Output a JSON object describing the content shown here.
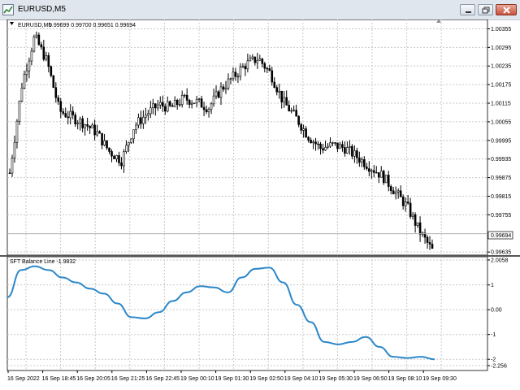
{
  "window": {
    "title": "EURUSD,M5"
  },
  "main_chart": {
    "header_symbol": "EURUSD,M5",
    "header_ohlc": "0.99699 0.99700 0.99651 0.99694",
    "current_price_label": "0.99694",
    "y_labels": [
      "1.00355",
      "1.00295",
      "1.00235",
      "1.00175",
      "1.00115",
      "1.00055",
      "0.99995",
      "0.99935",
      "0.99875",
      "0.99815",
      "0.99755",
      "0.99635"
    ]
  },
  "indicator": {
    "header": "SFT Balance Line -1.9832",
    "y_labels": [
      "2.0058",
      "1",
      "0.00",
      "-1",
      "-2",
      "-2.256"
    ]
  },
  "time_axis": [
    "16 Sep 2022",
    "16 Sep 18:45",
    "16 Sep 20:05",
    "16 Sep 21:25",
    "16 Sep 22:45",
    "19 Sep 00:10",
    "19 Sep 01:30",
    "19 Sep 02:50",
    "19 Sep 04:10",
    "19 Sep 05:30",
    "19 Sep 06:50",
    "19 Sep 08:10",
    "19 Sep 09:30"
  ],
  "chart_data": [
    {
      "type": "candlestick",
      "title": "EURUSD,M5",
      "x_categories": [
        "16 Sep 2022",
        "16 Sep 18:45",
        "16 Sep 20:05",
        "16 Sep 21:25",
        "16 Sep 22:45",
        "19 Sep 00:10",
        "19 Sep 01:30",
        "19 Sep 02:50",
        "19 Sep 04:10",
        "19 Sep 05:30",
        "19 Sep 06:50",
        "19 Sep 08:10",
        "19 Sep 09:30"
      ],
      "ylim": [
        0.99625,
        1.00385
      ],
      "close_path_approx": [
        0.9989,
        1.0018,
        1.0033,
        1.0025,
        1.0009,
        1.0007,
        1.0005,
        1.0002,
        0.9996,
        0.9993,
        1.0004,
        1.0008,
        1.0011,
        1.001,
        1.0013,
        1.0012,
        1.001,
        1.0016,
        1.002,
        1.0024,
        1.0026,
        1.0021,
        1.0012,
        1.0007,
        1.0001,
        0.9997,
        0.9998,
        0.9997,
        0.9994,
        0.9991,
        0.9988,
        0.9983,
        0.9978,
        0.997,
        0.9964
      ],
      "last_price": 0.99694,
      "grid": true
    },
    {
      "type": "line",
      "title": "SFT Balance Line -1.9832",
      "ylim": [
        -2.256,
        2.0058
      ],
      "series": [
        {
          "name": "SFT Balance Line",
          "values": [
            0.5,
            1.6,
            1.75,
            1.6,
            1.3,
            1.1,
            0.85,
            0.65,
            0.25,
            -0.3,
            -0.35,
            -0.1,
            0.35,
            0.7,
            0.95,
            0.9,
            0.7,
            1.3,
            1.65,
            1.7,
            1.1,
            0.2,
            -0.5,
            -1.3,
            -1.4,
            -1.3,
            -1.1,
            -1.5,
            -1.9,
            -1.95,
            -1.9,
            -2.0
          ]
        }
      ],
      "grid": true
    }
  ]
}
